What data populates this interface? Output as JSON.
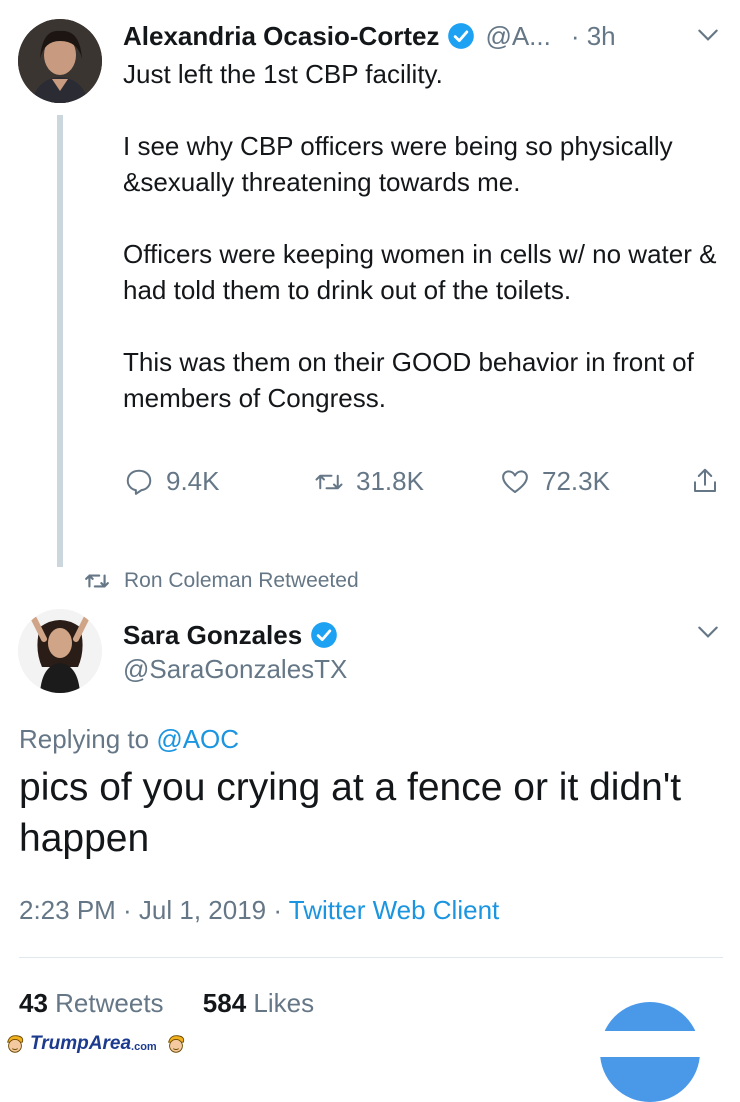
{
  "tweet1": {
    "name": "Alexandria Ocasio-Cortez",
    "handle": "@A...",
    "time": "· 3h",
    "text": "Just left the 1st CBP facility.\n\nI see why CBP officers were being so physically &sexually threatening towards me.\n\nOfficers were keeping women in cells w/ no water & had told them to drink out of the toilets.\n\nThis was them on their GOOD behavior in front of members of Congress.",
    "replies": "9.4K",
    "retweets": "31.8K",
    "likes": "72.3K"
  },
  "retweeted_by": "Ron Coleman Retweeted",
  "tweet2": {
    "name": "Sara Gonzales",
    "handle": "@SaraGonzalesTX",
    "replying_prefix": "Replying to",
    "replying_to": "@AOC",
    "text": "pics of you crying at a fence or it didn't happen",
    "timestamp": "2:23 PM · Jul 1, 2019 · ",
    "client": "Twitter Web Client",
    "retweet_count": "43",
    "retweet_label": "Retweets",
    "like_count": "584",
    "like_label": "Likes"
  },
  "watermark": {
    "brand": "TrumpArea",
    "suffix": ".com"
  },
  "colors": {
    "verified": "#1da1f2",
    "link": "#1b95e0",
    "muted": "#657786",
    "thread_line": "#ccd6dd"
  }
}
